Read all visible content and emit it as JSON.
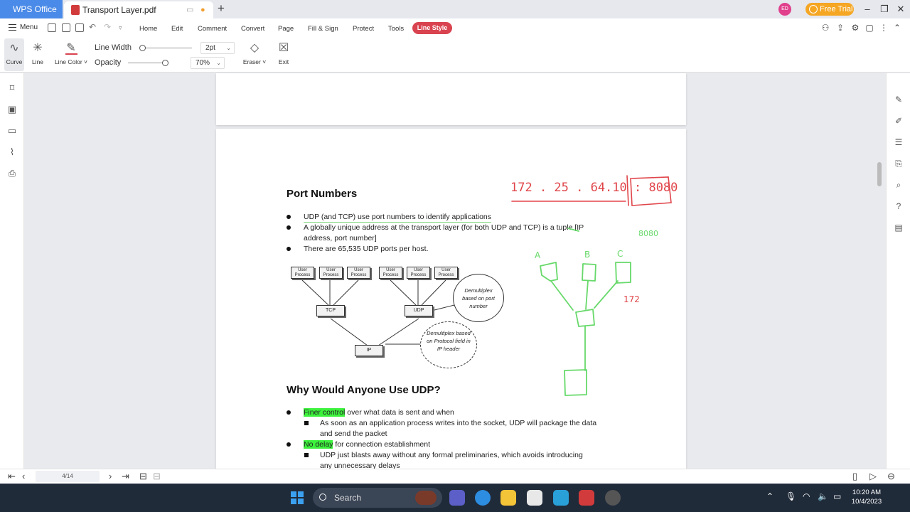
{
  "titlebar": {
    "app_tab": "WPS Office",
    "doc_tab": "Transport Layer.pdf",
    "avatar": "ED",
    "free_trial": "Free Trial"
  },
  "menu": {
    "menu_label": "Menu",
    "items": [
      "Home",
      "Edit",
      "Comment",
      "Convert",
      "Page",
      "Fill & Sign",
      "Protect",
      "Tools"
    ],
    "active": "Line Style"
  },
  "toolbar": {
    "curve": "Curve",
    "line": "Line",
    "line_color": "Line Color ˅",
    "line_width_label": "Line Width",
    "line_width_value": "2pt",
    "opacity_label": "Opacity",
    "opacity_value": "70%",
    "eraser": "Eraser ˅",
    "exit": "Exit"
  },
  "document": {
    "section1_title": "Port Numbers",
    "bullets1": [
      "UDP (and TCP) use port numbers to identify applications",
      "A globally unique address at the transport layer (for both UDP and TCP) is a tuple [IP",
      "address, port number]",
      "There are 65,535 UDP ports per host."
    ],
    "diagram": {
      "user_process": "User Process",
      "tcp": "TCP",
      "udp": "UDP",
      "ip": "IP",
      "demux_port": "Demultiplex based on port number",
      "demux_proto": "Demultiplex based on Protocol field in IP header"
    },
    "section2_title": "Why Would Anyone Use UDP?",
    "b2_1_hl": "Finer control",
    "b2_1_rest": " over what data is sent and when",
    "b2_1_sub_a": "As soon as an application process writes into the socket, UDP will package the data",
    "b2_1_sub_b": "and send the packet",
    "b2_2_hl": "No delay",
    "b2_2_rest": " for connection establishment",
    "b2_2_sub_a": "UDP just blasts away without any formal preliminaries, which avoids introducing",
    "b2_2_sub_b": "any unnecessary delays"
  },
  "ink": {
    "ip_note": "172 . 25 . 64.10 : 8080",
    "port_note": "8080",
    "labels": [
      "A",
      "B",
      "C"
    ],
    "small_note": "172",
    "red_color": "#e0454a",
    "green_color": "#67d96a"
  },
  "statusbar": {
    "page_indicator": "4/14"
  },
  "taskbar": {
    "search": "Search",
    "time": "10:20 AM",
    "date": "10/4/2023"
  }
}
